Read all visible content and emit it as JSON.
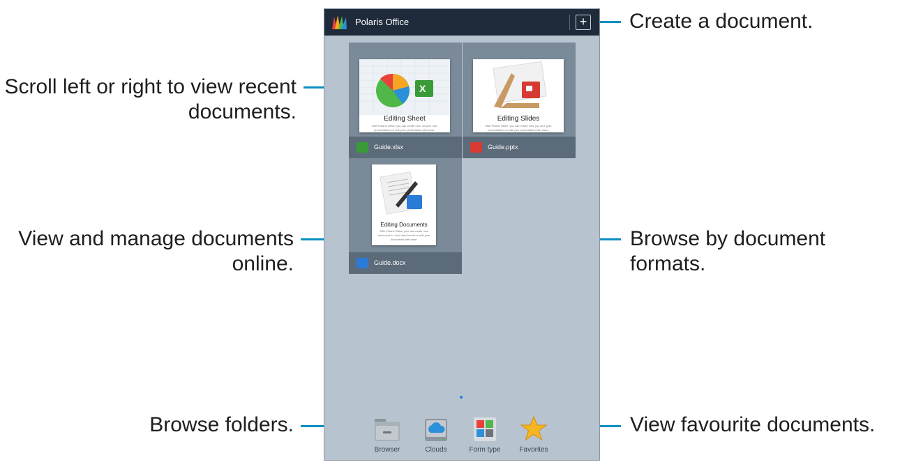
{
  "app": {
    "title": "Polaris Office"
  },
  "documents": [
    {
      "file_name": "Guide.xlsx",
      "thumb_title": "Editing Sheet",
      "thumb_text": "With Polaris Office, you can create new .xls and .xlsx presentations or edit your presentation with ease.",
      "type_color": "#3a9a37"
    },
    {
      "file_name": "Guide.pptx",
      "thumb_title": "Editing Slides",
      "thumb_text": "With Polaris Office, you can create new .ppt and .pptx presentations or edit your presentation with ease.",
      "type_color": "#d63a32"
    },
    {
      "file_name": "Guide.docx",
      "thumb_title": "Editing Documents",
      "thumb_text": "With Polaris Office, you can create new document in .doc/.docx format or edit your documents with ease.",
      "type_color": "#2a7bd6"
    }
  ],
  "dock": [
    {
      "label": "Browser",
      "icon": "folder-icon"
    },
    {
      "label": "Clouds",
      "icon": "cloud-drive-icon"
    },
    {
      "label": "Form type",
      "icon": "form-type-icon"
    },
    {
      "label": "Favorites",
      "icon": "star-icon"
    }
  ],
  "callouts": {
    "create": "Create a document.",
    "scroll_line1": "Scroll left or right to view recent",
    "scroll_line2": "documents.",
    "online_line1": "View and manage documents",
    "online_line2": "online.",
    "formats": "Browse by document formats.",
    "folders": "Browse folders.",
    "favourites": "View favourite documents."
  },
  "colors": {
    "callout_line": "#0a8fc4",
    "titlebar": "#1f2a3a",
    "screen_bg": "#b7c4cf"
  }
}
